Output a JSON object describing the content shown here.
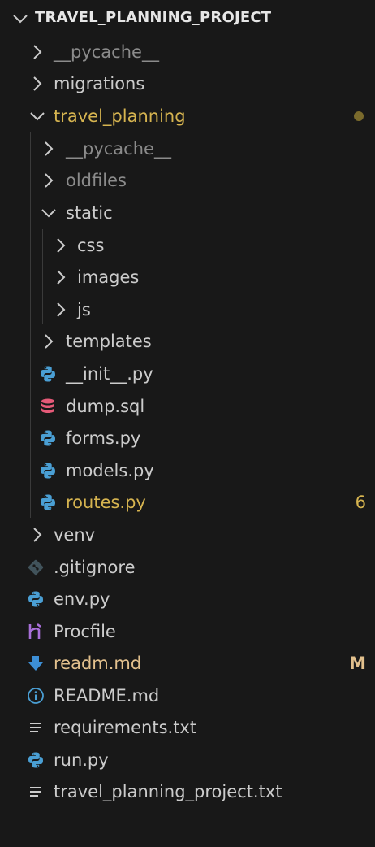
{
  "explorer": {
    "project_title": "TRAVEL_PLANNING_PROJECT",
    "colors": {
      "background": "#181818",
      "text": "#cccccc",
      "muted": "#8b8b8b",
      "warning_yellow": "#d6b450",
      "modified": "#e2c08d",
      "python_icon": "#4a9fd4",
      "database_icon": "#e65a78",
      "heroku_icon": "#a86fd8",
      "markdown_icon": "#3d8fd6"
    },
    "items": [
      {
        "label": "__pycache__",
        "type": "folder",
        "state": "collapsed",
        "badge": ""
      },
      {
        "label": "migrations",
        "type": "folder",
        "state": "collapsed",
        "badge": ""
      },
      {
        "label": "travel_planning",
        "type": "folder",
        "state": "expanded",
        "badge": ""
      },
      {
        "label": "__pycache__",
        "type": "folder",
        "state": "collapsed",
        "badge": ""
      },
      {
        "label": "oldfiles",
        "type": "folder",
        "state": "collapsed",
        "badge": ""
      },
      {
        "label": "static",
        "type": "folder",
        "state": "expanded",
        "badge": ""
      },
      {
        "label": "css",
        "type": "folder",
        "state": "collapsed",
        "badge": ""
      },
      {
        "label": "images",
        "type": "folder",
        "state": "collapsed",
        "badge": ""
      },
      {
        "label": "js",
        "type": "folder",
        "state": "collapsed",
        "badge": ""
      },
      {
        "label": "templates",
        "type": "folder",
        "state": "collapsed",
        "badge": ""
      },
      {
        "label": "__init__.py",
        "type": "file",
        "icon": "python-icon",
        "badge": ""
      },
      {
        "label": "dump.sql",
        "type": "file",
        "icon": "database-icon",
        "badge": ""
      },
      {
        "label": "forms.py",
        "type": "file",
        "icon": "python-icon",
        "badge": ""
      },
      {
        "label": "models.py",
        "type": "file",
        "icon": "python-icon",
        "badge": ""
      },
      {
        "label": "routes.py",
        "type": "file",
        "icon": "python-icon",
        "badge": "6"
      },
      {
        "label": "venv",
        "type": "folder",
        "state": "collapsed",
        "badge": ""
      },
      {
        "label": ".gitignore",
        "type": "file",
        "icon": "git-icon",
        "badge": ""
      },
      {
        "label": "env.py",
        "type": "file",
        "icon": "python-icon",
        "badge": ""
      },
      {
        "label": "Procfile",
        "type": "file",
        "icon": "heroku-icon",
        "badge": ""
      },
      {
        "label": "readm.md",
        "type": "file",
        "icon": "download-arrow-icon",
        "badge": "M"
      },
      {
        "label": "README.md",
        "type": "file",
        "icon": "info-icon",
        "badge": ""
      },
      {
        "label": "requirements.txt",
        "type": "file",
        "icon": "text-file-icon",
        "badge": ""
      },
      {
        "label": "run.py",
        "type": "file",
        "icon": "python-icon",
        "badge": ""
      },
      {
        "label": "travel_planning_project.txt",
        "type": "file",
        "icon": "text-file-icon",
        "badge": ""
      }
    ]
  }
}
